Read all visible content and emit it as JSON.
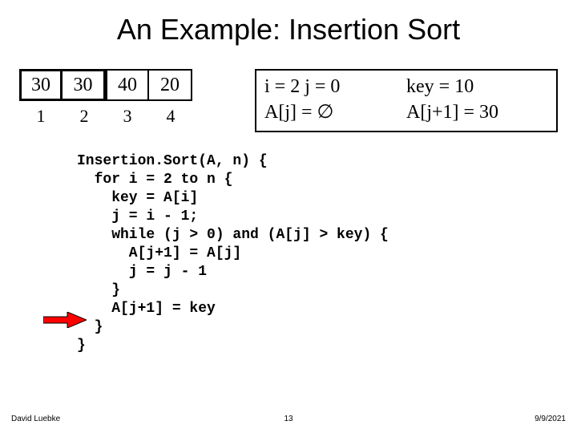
{
  "title": "An Example: Insertion Sort",
  "array": {
    "c0": "30",
    "c1": "30",
    "c2": "40",
    "c3": "20"
  },
  "idx": {
    "i0": "1",
    "i1": "2",
    "i2": "3",
    "i3": "4"
  },
  "state": {
    "l1a": "i = 2    j = 0",
    "l1b": "key = 10",
    "l2a": "A[j] = ∅",
    "l2b": "A[j+1] = 30"
  },
  "code": "Insertion.Sort(A, n) {\n  for i = 2 to n {\n    key = A[i]\n    j = i - 1;\n    while (j > 0) and (A[j] > key) {\n      A[j+1] = A[j]\n      j = j - 1\n    }\n    A[j+1] = key\n  }\n}",
  "footer": {
    "author": "David Luebke",
    "page": "13",
    "date": "9/9/2021"
  }
}
